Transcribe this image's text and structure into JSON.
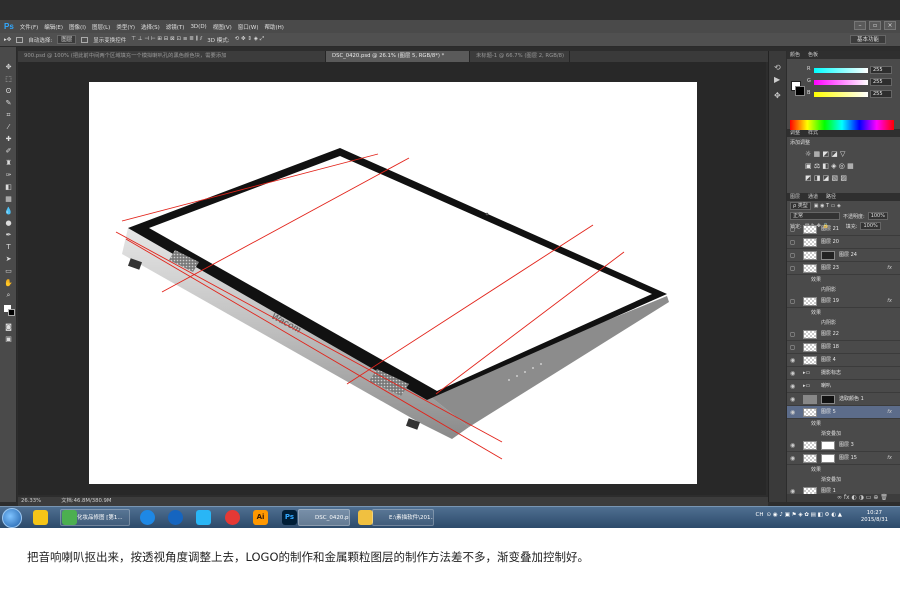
{
  "app": {
    "logo": "Ps"
  },
  "menu": [
    "文件(F)",
    "编辑(E)",
    "图像(I)",
    "图层(L)",
    "类型(Y)",
    "选择(S)",
    "滤镜(T)",
    "3D(D)",
    "视图(V)",
    "窗口(W)",
    "帮助(H)"
  ],
  "options": {
    "auto_select_label": "自动选择:",
    "auto_select_value": "图层",
    "show_transform_label": "显示变换控件",
    "mode_3d": "3D 模式:",
    "workspace": "基本功能"
  },
  "tabs": [
    {
      "label": "900.psd @ 100% (把此前中间两个区域填充一个模拟喇叭孔的黑色颜色块，需要添加",
      "active": false
    },
    {
      "label": "DSC_0420.psd @ 26.1% (图层 5, RGB/8*) *",
      "active": true
    },
    {
      "label": "未标题-1 @ 66.7% (图层 2, RGB/8)",
      "active": false
    }
  ],
  "status": {
    "zoom": "26.33%",
    "doc": "文档:46.8M/380.9M"
  },
  "color_panel": {
    "tabs": [
      "颜色",
      "色板"
    ],
    "r_label": "R",
    "g_label": "G",
    "b_label": "B",
    "r": "255",
    "g": "255",
    "b": "255"
  },
  "adjust_panel": {
    "tabs": [
      "调整",
      "样式"
    ],
    "title": "添加调整"
  },
  "layers_panel": {
    "tabs": [
      "图层",
      "通道",
      "路径"
    ],
    "kind": "ρ 类型",
    "blend": "正常",
    "opacity_label": "不透明度:",
    "opacity": "100%",
    "lock_label": "锁定:",
    "fill_label": "填充:",
    "fill": "100%",
    "fx": "fx",
    "effects_label": "效果",
    "layers": [
      {
        "name": "图层 21",
        "kind": "layer"
      },
      {
        "name": "图层 20",
        "kind": "layer"
      },
      {
        "name": "图层 24",
        "kind": "mask"
      },
      {
        "name": "图层 23",
        "kind": "layer",
        "fx": true,
        "effects": [
          "内阴影"
        ]
      },
      {
        "name": "图层 19",
        "kind": "layer",
        "fx": true,
        "effects": [
          "内阴影"
        ]
      },
      {
        "name": "图层 22",
        "kind": "layer"
      },
      {
        "name": "图层 18",
        "kind": "layer"
      },
      {
        "name": "图层 4",
        "kind": "layer"
      },
      {
        "name": "摄影标志",
        "kind": "group"
      },
      {
        "name": "喇叭",
        "kind": "group"
      },
      {
        "name": "选取颜色 1",
        "kind": "adjust"
      },
      {
        "name": "图层 5",
        "kind": "layer",
        "fx": true,
        "selected": true,
        "effects": [
          "渐变叠加"
        ]
      },
      {
        "name": "图层 3",
        "kind": "mask"
      },
      {
        "name": "图层 15",
        "kind": "mask",
        "fx": true,
        "effects": [
          "渐变叠加"
        ]
      },
      {
        "name": "图层 1",
        "kind": "layer"
      }
    ]
  },
  "taskbar": {
    "items": [
      {
        "label": "",
        "color": "#f5c518"
      },
      {
        "label": "化妆品修图 [第1...",
        "color": "#4caf50"
      },
      {
        "label": "",
        "color": "#1e88e5"
      },
      {
        "label": "",
        "color": "#1565c0"
      },
      {
        "label": "",
        "color": "#29b6f6"
      },
      {
        "label": "",
        "color": "#e53935"
      },
      {
        "label": "Ai",
        "color": "#ff9800"
      },
      {
        "label": "Ps",
        "color": "#001e36"
      },
      {
        "label": "DSC_0420.psd ...",
        "color": "#3a6ea5"
      },
      {
        "label": "E:\\素描软件\\201...",
        "color": "#f0c040"
      }
    ],
    "tray_lang": "CH",
    "time": "10:27",
    "date": "2015/8/31"
  },
  "caption": "把音响喇叭抠出来，按透视角度调整上去，LOGO的制作和金属颗粒图层的制作方法差不多，渐变叠加控制好。",
  "device_logo": "Wacom"
}
